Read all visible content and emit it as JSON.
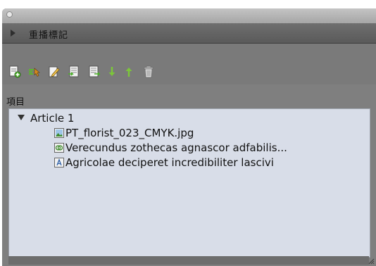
{
  "panel": {
    "header_title": "重播標記",
    "section_label": "項目"
  },
  "toolbar": {
    "buttons": [
      {
        "name": "new-item-icon"
      },
      {
        "name": "select-item-icon"
      },
      {
        "name": "edit-item-icon"
      },
      {
        "name": "import-icon"
      },
      {
        "name": "export-icon"
      },
      {
        "name": "move-down-icon"
      },
      {
        "name": "move-up-icon"
      },
      {
        "name": "trash-icon"
      }
    ]
  },
  "tree": {
    "article": {
      "label": "Article 1"
    },
    "items": [
      {
        "label": "PT_florist_023_CMYK.jpg",
        "icon": "image-icon"
      },
      {
        "label": "Verecundus zothecas agnascor adfabilis...",
        "icon": "link-icon"
      },
      {
        "label": "Agricolae deciperet incredibiliter lascivi",
        "icon": "text-icon"
      }
    ]
  },
  "colors": {
    "panel_bg": "#7a7a7a",
    "tree_bg": "#d8dde8",
    "accent_green": "#5cb82e"
  }
}
